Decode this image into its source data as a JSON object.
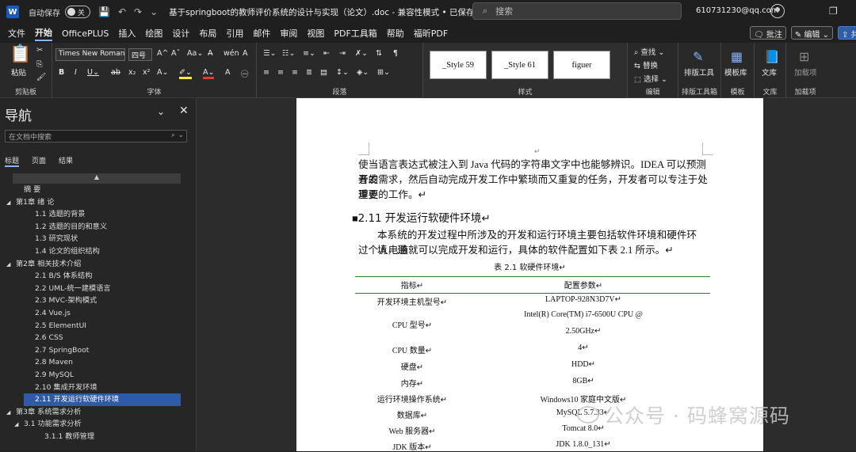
{
  "titlebar": {
    "app_logo": "W",
    "autosave_label": "自动保存",
    "autosave_state": "关",
    "doc_title": "基于springboot的教师评价系统的设计与实现（论文）.doc  -  兼容性模式 • 已保存 ⌄",
    "search_placeholder": "搜索",
    "user_email": "610731230@qq.com"
  },
  "menu": {
    "items": [
      "文件",
      "开始",
      "OfficePLUS",
      "插入",
      "绘图",
      "设计",
      "布局",
      "引用",
      "邮件",
      "审阅",
      "视图",
      "PDF工具箱",
      "帮助",
      "福昕PDF"
    ],
    "comment": "批注",
    "edit": "编辑",
    "share": "共享"
  },
  "ribbon": {
    "clipboard": {
      "paste": "粘贴",
      "label": "剪贴板"
    },
    "font": {
      "name": "Times New Roman",
      "size": "四号",
      "label": "字体"
    },
    "paragraph": {
      "label": "段落"
    },
    "styles": {
      "items": [
        "_Style 59",
        "_Style 61",
        "figuer"
      ],
      "label": "样式"
    },
    "editing": {
      "find": "查找",
      "replace": "替换",
      "select": "选择",
      "label": "编辑"
    },
    "layout_tool": {
      "name": "排版工具",
      "label": "排版工具箱"
    },
    "template": {
      "name": "模板库",
      "label": "模板"
    },
    "library": {
      "name": "文库",
      "label": "文库"
    },
    "addins": {
      "name": "加载项",
      "label": "加载项"
    }
  },
  "nav": {
    "title": "导航",
    "search_placeholder": "在文档中搜索",
    "tabs": [
      "标题",
      "页面",
      "结果"
    ],
    "items": [
      {
        "text": "摘  要",
        "level": 1,
        "arrow": ""
      },
      {
        "text": "第1章  绪  论",
        "level": 0,
        "arrow": "◢"
      },
      {
        "text": "1.1  选题的背景",
        "level": 2,
        "arrow": ""
      },
      {
        "text": "1.2  选题的目的和意义",
        "level": 2,
        "arrow": ""
      },
      {
        "text": "1.3  研究现状",
        "level": 2,
        "arrow": ""
      },
      {
        "text": "1.4  论文的组织结构",
        "level": 2,
        "arrow": ""
      },
      {
        "text": "第2章  相关技术介绍",
        "level": 0,
        "arrow": "◢"
      },
      {
        "text": "2.1  B/S 体系结构",
        "level": 2,
        "arrow": ""
      },
      {
        "text": "2.2  UML-统一建模语言",
        "level": 2,
        "arrow": ""
      },
      {
        "text": "2.3  MVC-架构模式",
        "level": 2,
        "arrow": ""
      },
      {
        "text": "2.4  Vue.js",
        "level": 2,
        "arrow": ""
      },
      {
        "text": "2.5  ElementUI",
        "level": 2,
        "arrow": ""
      },
      {
        "text": "2.6  CSS",
        "level": 2,
        "arrow": ""
      },
      {
        "text": "2.7 SpringBoot",
        "level": 2,
        "arrow": ""
      },
      {
        "text": "2.8  Maven",
        "level": 2,
        "arrow": ""
      },
      {
        "text": "2.9  MySQL",
        "level": 2,
        "arrow": ""
      },
      {
        "text": "2.10  集成开发环境",
        "level": 2,
        "arrow": ""
      },
      {
        "text": "2.11  开发运行软硬件环境",
        "level": 2,
        "arrow": "",
        "selected": true
      },
      {
        "text": "第3章 系统需求分析",
        "level": 0,
        "arrow": "◢"
      },
      {
        "text": "3.1  功能需求分析",
        "level": 1,
        "arrow": "◢"
      },
      {
        "text": "3.1.1  教师管理",
        "level": 3,
        "arrow": ""
      }
    ]
  },
  "document": {
    "para1": [
      "使当语言表达式被注入到 Java 代码的字符串文字中也能够辨识。IDEA 可以预测开发",
      "者的需求，然后自动完成开发工作中繁琐而又重复的任务，开发者可以专注于处理更",
      "重要的工作。↵"
    ],
    "heading": "2.11  开发运行软硬件环境↵",
    "para2": [
      "本系统的开发过程中所涉及的开发和运行环境主要包括软件环境和硬件环境，通",
      "过个人电脑就可以完成开发和运行，具体的软件配置如下表 2.1 所示。↵"
    ],
    "table_caption": "表 2.1  软硬件环境↵",
    "table_headers": [
      "指标↵",
      "配置参数↵"
    ],
    "table_rows": [
      [
        "开发环境主机型号↵",
        "LAPTOP-928N3D7V↵"
      ],
      [
        "CPU 型号↵",
        "Intel(R) Core(TM) i7-6500U CPU @"
      ],
      [
        "",
        "2.50GHz↵"
      ],
      [
        "CPU 数量↵",
        "4↵"
      ],
      [
        "硬盘↵",
        "HDD↵"
      ],
      [
        "内存↵",
        "8GB↵"
      ],
      [
        "运行环境操作系统↵",
        "Windows10 家庭中文版↵"
      ],
      [
        "数据库↵",
        "MySQL 5.7.33↵"
      ],
      [
        "Web 服务器↵",
        "Tomcat 8.0↵"
      ],
      [
        "JDK 版本↵",
        "JDK 1.8.0_131↵"
      ]
    ]
  },
  "watermark": "公众号 · 码蜂窝源码"
}
